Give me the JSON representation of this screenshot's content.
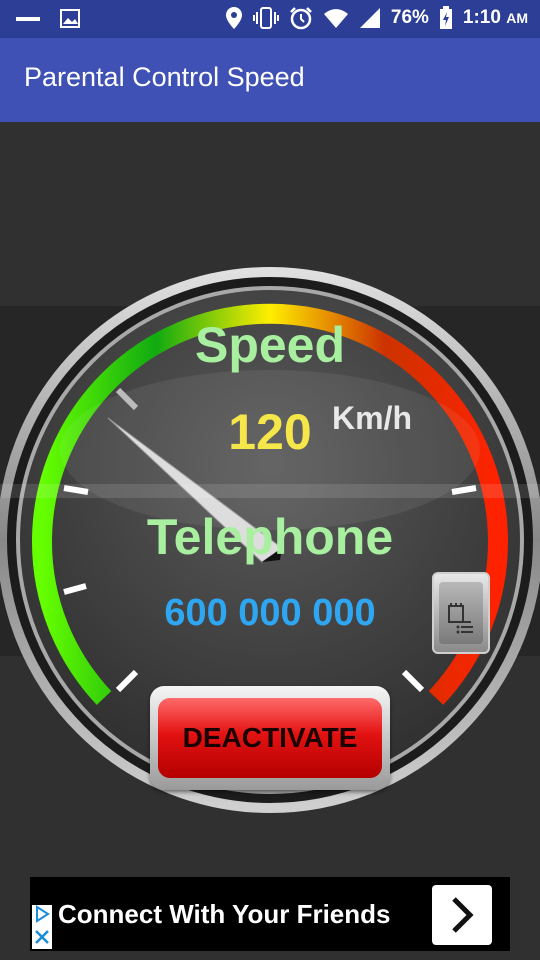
{
  "status_bar": {
    "battery": "76%",
    "time": "1:10",
    "ampm": "AM",
    "icons": [
      "minus-icon",
      "image-icon",
      "location-icon",
      "vibrate-icon",
      "alarm-icon",
      "wifi-icon",
      "signal-icon",
      "battery-icon"
    ]
  },
  "app_bar": {
    "title": "Parental Control Speed",
    "color": "#3f51b5"
  },
  "gauge": {
    "speed_label": "Speed",
    "speed_value": "120",
    "speed_unit": "Km/h",
    "phone_label": "Telephone",
    "phone_value": "600 000 000",
    "arc_colors": [
      "#66ff00",
      "#00bb00",
      "#ffee00",
      "#ff2200"
    ]
  },
  "buttons": {
    "deactivate_label": "DEACTIVATE",
    "contacts_icon": "contacts-list-icon"
  },
  "ad": {
    "text": "Connect With Your Friends",
    "arrow_icon": "chevron-right-icon"
  }
}
